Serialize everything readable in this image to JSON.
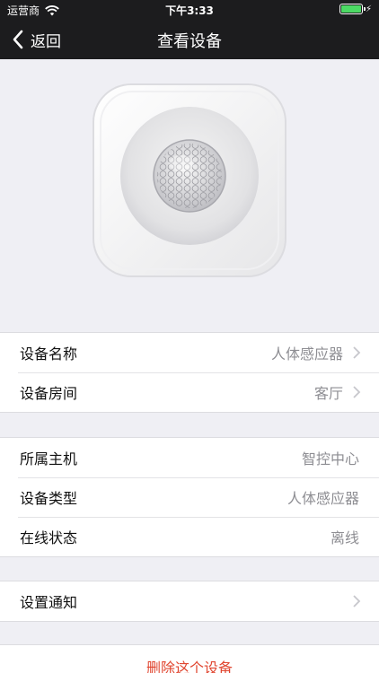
{
  "status_bar": {
    "carrier": "运营商",
    "time": "下午3:33",
    "battery_color": "#4cd964"
  },
  "nav": {
    "back_label": "返回",
    "title": "查看设备"
  },
  "device_image": {
    "icon": "motion-sensor-image"
  },
  "group1": [
    {
      "label": "设备名称",
      "value": "人体感应器",
      "arrow": true
    },
    {
      "label": "设备房间",
      "value": "客厅",
      "arrow": true
    }
  ],
  "group2": [
    {
      "label": "所属主机",
      "value": "智控中心"
    },
    {
      "label": "设备类型",
      "value": "人体感应器"
    },
    {
      "label": "在线状态",
      "value": "离线"
    }
  ],
  "group3": [
    {
      "label": "设置通知",
      "arrow": true
    }
  ],
  "delete": {
    "label": "删除这个设备",
    "color": "#e0452f"
  }
}
